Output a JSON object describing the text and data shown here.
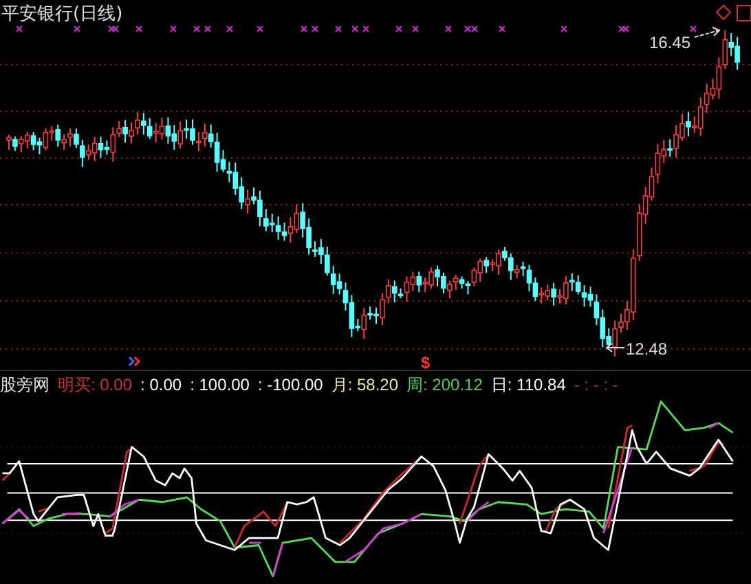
{
  "title": "平安银行(日线)",
  "price_chart": {
    "high_label": "16.45",
    "low_label": "12.48",
    "signal_mark": "$"
  },
  "indicator": {
    "name": "股旁网",
    "legend": [
      {
        "label": "明买:",
        "value": "0.00",
        "color": "#d03030"
      },
      {
        "label": ":",
        "value": "0.00",
        "color": "#ffffff"
      },
      {
        "label": ":",
        "value": "100.00",
        "color": "#ffffff"
      },
      {
        "label": ":",
        "value": "-100.00",
        "color": "#ffffff"
      },
      {
        "label": "月:",
        "value": "58.20",
        "color": "#e8e8a0"
      },
      {
        "label": "周:",
        "value": "200.12",
        "color": "#50d050"
      },
      {
        "label": "日:",
        "value": "110.84",
        "color": "#ffffff"
      },
      {
        "value": "- : - : -",
        "color": "#a0306a"
      }
    ]
  }
}
